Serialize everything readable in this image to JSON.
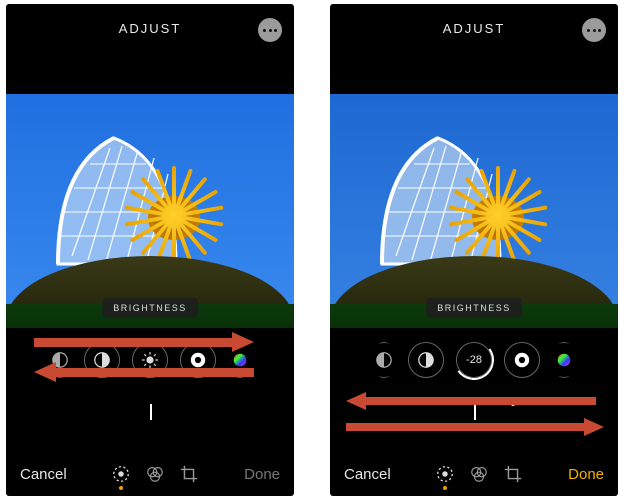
{
  "screens": [
    {
      "header": {
        "title": "ADJUST"
      },
      "adjustment_label": "BRIGHTNESS",
      "tools_value_display": null,
      "bottom": {
        "cancel": "Cancel",
        "done": "Done",
        "done_active": false
      },
      "arrows": "horizontal-tools"
    },
    {
      "header": {
        "title": "ADJUST"
      },
      "adjustment_label": "BRIGHTNESS",
      "tools_value_display": "-28",
      "bottom": {
        "cancel": "Cancel",
        "done": "Done",
        "done_active": true
      },
      "arrows": "horizontal-slider"
    }
  ],
  "adjustment_tools": [
    {
      "name": "shadows-icon"
    },
    {
      "name": "contrast-icon"
    },
    {
      "name": "brightness-icon"
    },
    {
      "name": "black-point-icon"
    },
    {
      "name": "saturation-icon"
    }
  ],
  "bottom_modes": [
    {
      "name": "adjust-mode-icon",
      "active": true
    },
    {
      "name": "filters-mode-icon",
      "active": false
    },
    {
      "name": "crop-mode-icon",
      "active": false
    }
  ],
  "colors": {
    "accent": "#f2b300",
    "arrow": "#c94a32"
  }
}
